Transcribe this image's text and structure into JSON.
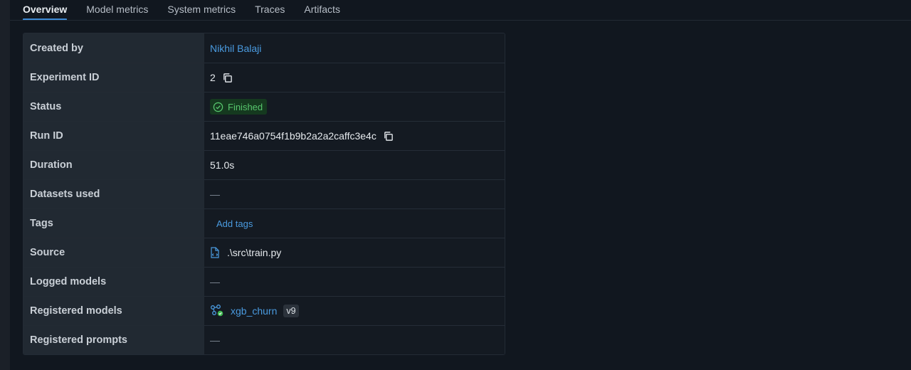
{
  "tabs": [
    {
      "label": "Overview",
      "active": true
    },
    {
      "label": "Model metrics"
    },
    {
      "label": "System metrics"
    },
    {
      "label": "Traces"
    },
    {
      "label": "Artifacts"
    }
  ],
  "details": {
    "created_by": {
      "label": "Created by",
      "value": "Nikhil Balaji"
    },
    "experiment_id": {
      "label": "Experiment ID",
      "value": "2",
      "icon": "copy-icon"
    },
    "status": {
      "label": "Status",
      "value": "Finished",
      "icon": "check-circle-icon"
    },
    "run_id": {
      "label": "Run ID",
      "value": "11eae746a0754f1b9b2a2a2caffc3e4c",
      "icon": "copy-icon"
    },
    "duration": {
      "label": "Duration",
      "value": "51.0s"
    },
    "datasets_used": {
      "label": "Datasets used",
      "value": "—"
    },
    "tags": {
      "label": "Tags",
      "value": "Add tags"
    },
    "source": {
      "label": "Source",
      "value": ".\\src\\train.py",
      "icon": "python-file-icon"
    },
    "logged_models": {
      "label": "Logged models",
      "value": "—"
    },
    "registered_models": {
      "label": "Registered models",
      "model_name": "xgb_churn",
      "version": "v9",
      "icon": "model-icon"
    },
    "registered_prompts": {
      "label": "Registered prompts",
      "value": "—"
    }
  },
  "colors": {
    "accent": "#3d8bd6",
    "link": "#4a9be0",
    "success": "#57c56d",
    "background": "#11171f"
  }
}
